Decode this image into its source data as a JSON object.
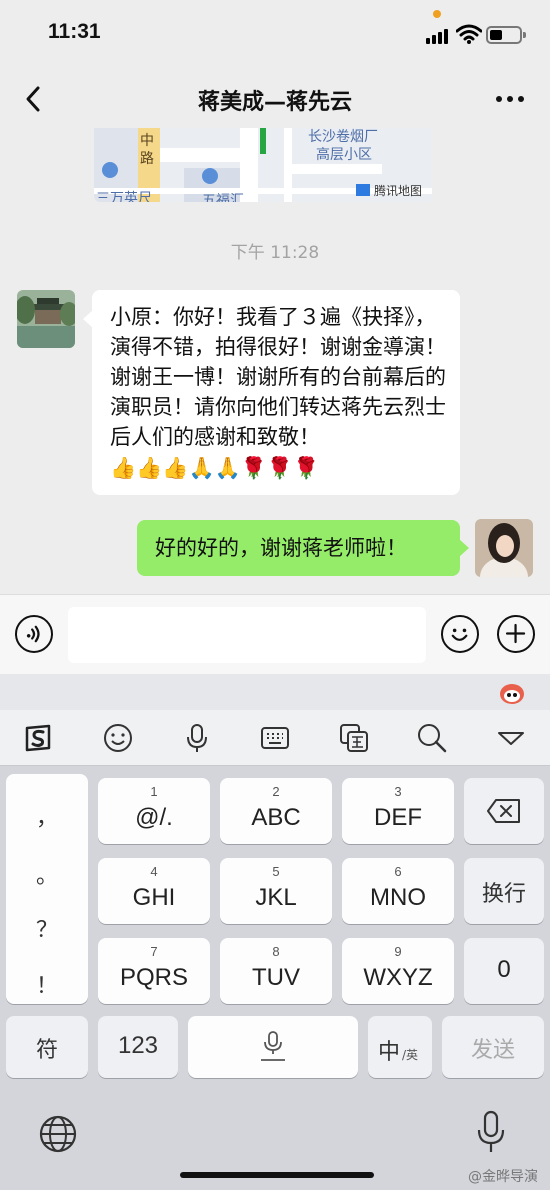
{
  "status": {
    "time": "11:31"
  },
  "nav": {
    "title": "蒋美成—蒋先云"
  },
  "map": {
    "labels": [
      "长沙卷烟厂",
      "高层小区",
      "中",
      "路",
      "三万英尺",
      "五福汇"
    ],
    "provider": "腾讯地图"
  },
  "timestamp": "下午 11:28",
  "messages": [
    {
      "side": "left",
      "text": "小原：你好！我看了３遍《抉择》，演得不错，拍得很好！谢谢金導演！谢谢王一博！谢谢所有的台前幕后的演职员！请你向他们转达蒋先云烈士后人们的感谢和致敬！",
      "emoji": "👍👍👍🙏🙏🌹🌹🌹"
    },
    {
      "side": "right",
      "text": "好的好的，谢谢蒋老师啦！"
    }
  ],
  "keyboard": {
    "punct": [
      "，",
      "。",
      "？",
      "！"
    ],
    "rows": [
      [
        {
          "num": "1",
          "label": "@/."
        },
        {
          "num": "2",
          "label": "ABC"
        },
        {
          "num": "3",
          "label": "DEF"
        }
      ],
      [
        {
          "num": "4",
          "label": "GHI"
        },
        {
          "num": "5",
          "label": "JKL"
        },
        {
          "num": "6",
          "label": "MNO"
        }
      ],
      [
        {
          "num": "7",
          "label": "PQRS"
        },
        {
          "num": "8",
          "label": "TUV"
        },
        {
          "num": "9",
          "label": "WXYZ"
        }
      ]
    ],
    "newline": "换行",
    "zero": "0",
    "symbol": "符",
    "num123": "123",
    "lang_main": "中",
    "lang_sub": "英",
    "send": "发送"
  },
  "watermark": "@金晔导演",
  "colors": {
    "bubble_green": "#95ec69",
    "bubble_white": "#ffffff",
    "chat_bg": "#ededed"
  }
}
